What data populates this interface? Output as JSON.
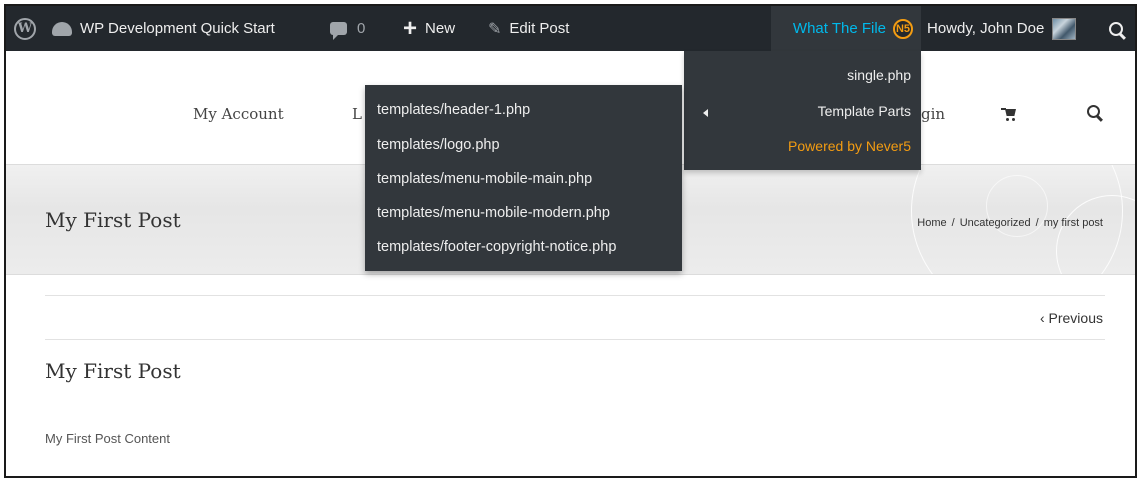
{
  "admin_bar": {
    "site_name": "WP Development Quick Start",
    "comments_count": "0",
    "new_label": "New",
    "edit_post_label": "Edit Post",
    "what_the_file_label": "What The File",
    "n5_badge": "N5",
    "howdy_label": "Howdy, John Doe",
    "icons": [
      "wordpress-logo-icon",
      "dashboard-icon",
      "comment-bubble-icon",
      "plus-icon",
      "pencil-icon",
      "never5-logo-icon",
      "avatar",
      "search-icon"
    ],
    "colors": {
      "bar_bg": "#23282d",
      "submenu_bg": "#32373c",
      "link_blue": "#00b9eb",
      "accent_orange": "#f39c12"
    }
  },
  "wtf_menu": {
    "file": "single.php",
    "template_parts": "Template Parts",
    "powered_by": "Powered by Never5"
  },
  "template_parts": [
    "templates/header-1.php",
    "templates/logo.php",
    "templates/menu-mobile-main.php",
    "templates/menu-mobile-modern.php",
    "templates/footer-copyright-notice.php"
  ],
  "site_nav": {
    "my_account": "My Account",
    "partial_left": "L",
    "partial_login": "ogin",
    "icons": [
      "cart-icon",
      "search-icon"
    ]
  },
  "page_title_bar": {
    "title": "My First Post",
    "breadcrumbs": [
      "Home",
      "Uncategorized",
      "my first post"
    ],
    "separator": "/"
  },
  "post": {
    "previous_link": "‹ Previous",
    "title": "My First Post",
    "content": "My First Post Content"
  }
}
